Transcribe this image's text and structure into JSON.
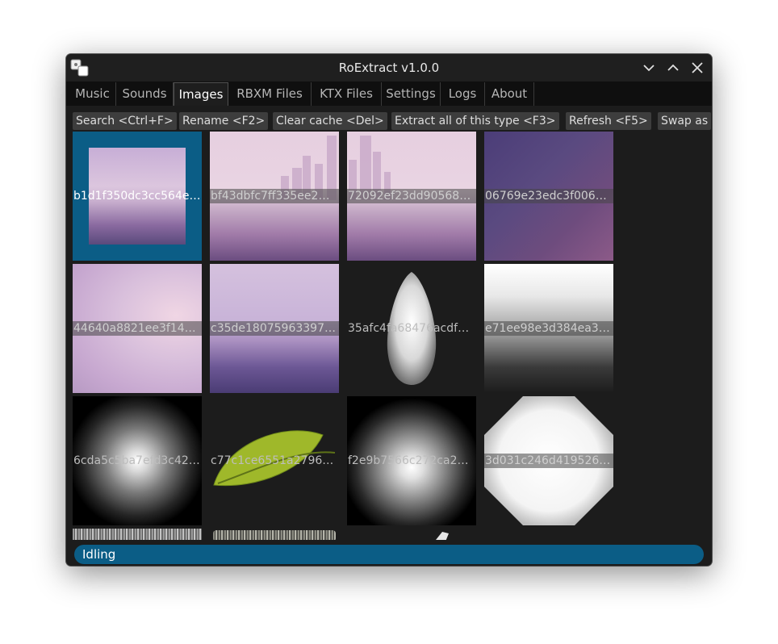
{
  "window": {
    "title": "RoExtract v1.0.0"
  },
  "tabs": [
    {
      "label": "Music",
      "active": false
    },
    {
      "label": "Sounds",
      "active": false
    },
    {
      "label": "Images",
      "active": true
    },
    {
      "label": "RBXM Files",
      "active": false
    },
    {
      "label": "KTX Files",
      "active": false
    },
    {
      "label": "Settings",
      "active": false
    },
    {
      "label": "Logs",
      "active": false
    },
    {
      "label": "About",
      "active": false
    }
  ],
  "toolbar": {
    "search": "Search <Ctrl+F>",
    "rename": "Rename <F2>",
    "clear_cache": "Clear cache <Del>",
    "extract_all": "Extract all of this type <F3>",
    "refresh": "Refresh <F5>",
    "swap": "Swap as"
  },
  "images": [
    {
      "name": "b1d1f350dc3cc564e…",
      "selected": true
    },
    {
      "name": "bf43dbfc7ff335ee2…"
    },
    {
      "name": "72092ef23dd90568…"
    },
    {
      "name": "06769e23edc3f006…"
    },
    {
      "name": "44640a8821ee3f14…"
    },
    {
      "name": "c35de18075963397…"
    },
    {
      "name": "35afc4fa68476acdf…"
    },
    {
      "name": "e71ee98e3d384ea3…"
    },
    {
      "name": "6cda5c5ba7efd3c42…"
    },
    {
      "name": "c77c1ce6551a2796…"
    },
    {
      "name": "f2e9b7566c272ca2…"
    },
    {
      "name": "3d031c246d419526…"
    }
  ],
  "status": {
    "text": "Idling"
  },
  "colors": {
    "accent": "#0b5d86",
    "background": "#1c1c1c",
    "tabbar": "#0f0f0f",
    "button": "#3d3d3d"
  }
}
